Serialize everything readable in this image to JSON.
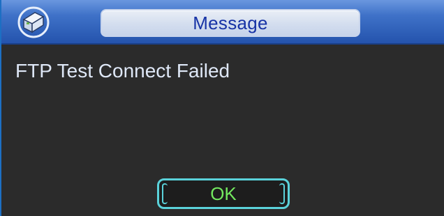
{
  "dialog": {
    "title": "Message",
    "message": "FTP Test Connect Failed",
    "ok_label": "OK"
  },
  "icons": {
    "app_icon": "dvr-device-icon"
  },
  "colors": {
    "titlebar": "#3f72c8",
    "title_text": "#1733a6",
    "body_background": "#2b2b2b",
    "message_text": "#dfe8f7",
    "button_border": "#5ad2da",
    "button_text": "#73e85f"
  }
}
